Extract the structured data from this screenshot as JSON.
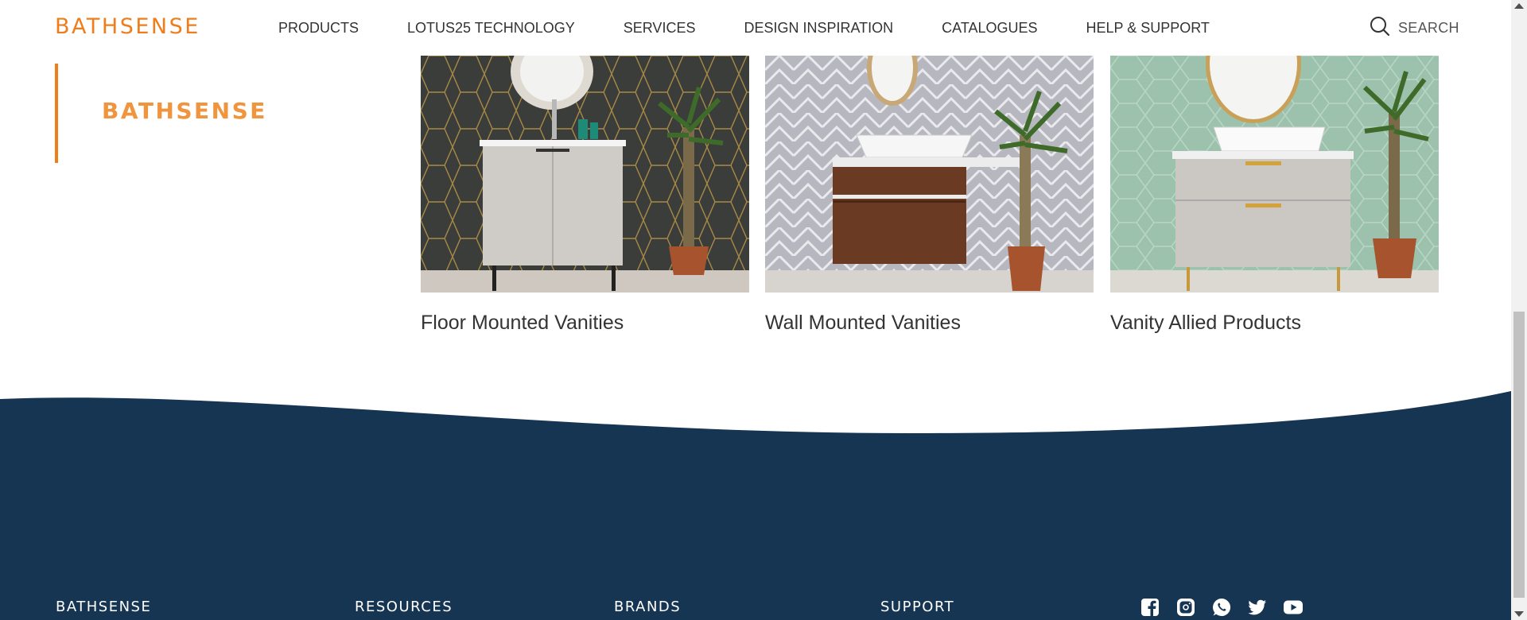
{
  "header": {
    "logo": "BATHSENSE",
    "nav": [
      "PRODUCTS",
      "LOTUS25 TECHNOLOGY",
      "SERVICES",
      "DESIGN INSPIRATION",
      "CATALOGUES",
      "HELP & SUPPORT"
    ],
    "search_label": "SEARCH",
    "search_icon": "search-icon"
  },
  "side_brand": {
    "logo": "BATHSENSE"
  },
  "products": [
    {
      "title": "Floor Mounted Vanities"
    },
    {
      "title": "Wall Mounted Vanities"
    },
    {
      "title": "Vanity Allied Products"
    }
  ],
  "footer": {
    "columns": [
      "BATHSENSE",
      "RESOURCES",
      "BRANDS",
      "SUPPORT"
    ],
    "socials": [
      "facebook-icon",
      "instagram-icon",
      "whatsapp-icon",
      "twitter-icon",
      "youtube-icon"
    ]
  },
  "colors": {
    "accent": "#ef7d1a",
    "footer": "#163552"
  }
}
